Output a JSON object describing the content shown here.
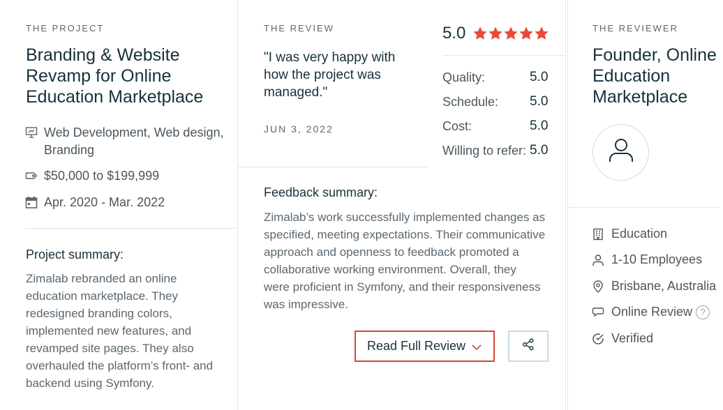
{
  "project": {
    "eyebrow": "THE PROJECT",
    "title_lines": [
      "Branding & Website",
      "Revamp for Online",
      "Education Marketplace"
    ],
    "services_line1": "Web Development, Web design,",
    "services_line2": "Branding",
    "budget": "$50,000 to $199,999",
    "dates": "Apr. 2020 - Mar. 2022",
    "summary_title": "Project summary:",
    "summary_lines": [
      "Zimalab rebranded an online",
      "education marketplace. They",
      "redesigned branding colors,",
      "implemented new features, and",
      "revamped site pages. They also",
      "overhauled the platform’s front- and",
      "backend using Symfony."
    ]
  },
  "review": {
    "eyebrow": "THE REVIEW",
    "quote_lines": [
      "\"I was very happy with",
      "how the project was",
      "managed.\""
    ],
    "date": "JUN 3, 2022",
    "overall": "5.0",
    "star_color": "#e8493d",
    "ratings": [
      {
        "label": "Quality:",
        "value": "5.0"
      },
      {
        "label": "Schedule:",
        "value": "5.0"
      },
      {
        "label": "Cost:",
        "value": "5.0"
      },
      {
        "label": "Willing to refer:",
        "value": "5.0"
      }
    ],
    "feedback_title": "Feedback summary:",
    "feedback_lines": [
      "Zimalab’s work successfully implemented changes as",
      "specified, meeting expectations. Their communicative",
      "approach and openness to feedback promoted a",
      "collaborative working environment. Overall, they",
      "were proficient in Symfony, and their responsiveness",
      "was impressive."
    ],
    "read_button": "Read Full Review"
  },
  "reviewer": {
    "eyebrow": "THE REVIEWER",
    "title_lines": [
      "Founder, Online",
      "Education",
      "Marketplace"
    ],
    "industry": "Education",
    "employees": "1-10 Employees",
    "location": "Brisbane, Australia",
    "review_type": "Online Review",
    "help_mark": "?",
    "status": "Verified"
  },
  "colors": {
    "accent_red": "#d8443a",
    "text_dark": "#17313b",
    "text_muted": "#5b6770",
    "divider": "#e3e6ea"
  }
}
